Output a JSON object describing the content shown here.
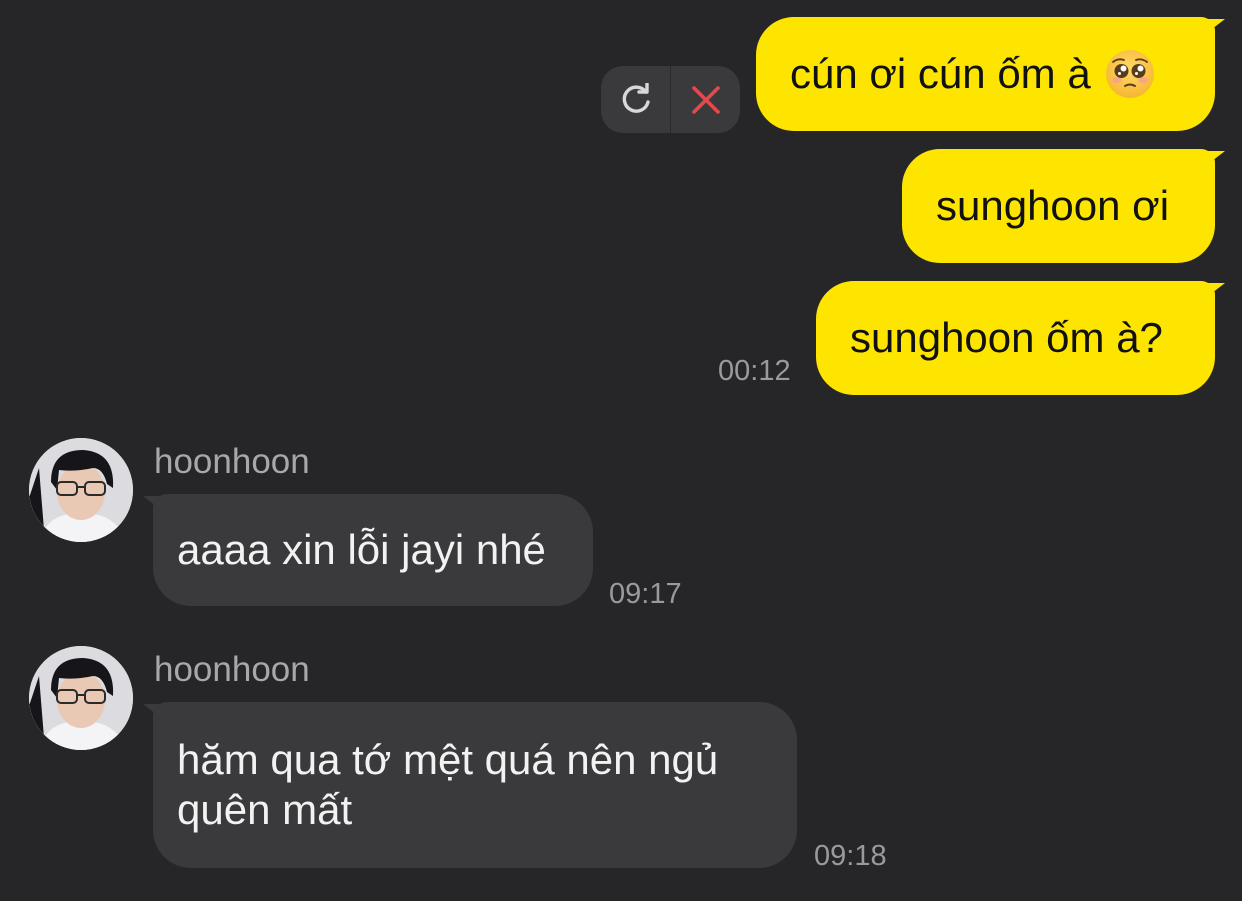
{
  "messages_outgoing": [
    {
      "text": "cún ơi cún ốm à",
      "emoji": "pleading-face"
    },
    {
      "text": "sunghoon ơi"
    },
    {
      "text": "sunghoon ốm à?",
      "time": "00:12"
    }
  ],
  "messages_incoming": [
    {
      "sender": "hoonhoon",
      "text": "aaaa xin lỗi jayi nhé",
      "time": "09:17"
    },
    {
      "sender": "hoonhoon",
      "line1": "hăm qua tớ mệt quá nên ngủ",
      "line2": "quên mất",
      "time": "09:18"
    }
  ],
  "resend_controls": {
    "retry_icon": "retry-icon",
    "cancel_icon": "close-icon",
    "cancel_color": "#E5484D"
  },
  "colors": {
    "background": "#262628",
    "outgoing_bubble": "#FEE500",
    "incoming_bubble": "#3a3a3c"
  }
}
